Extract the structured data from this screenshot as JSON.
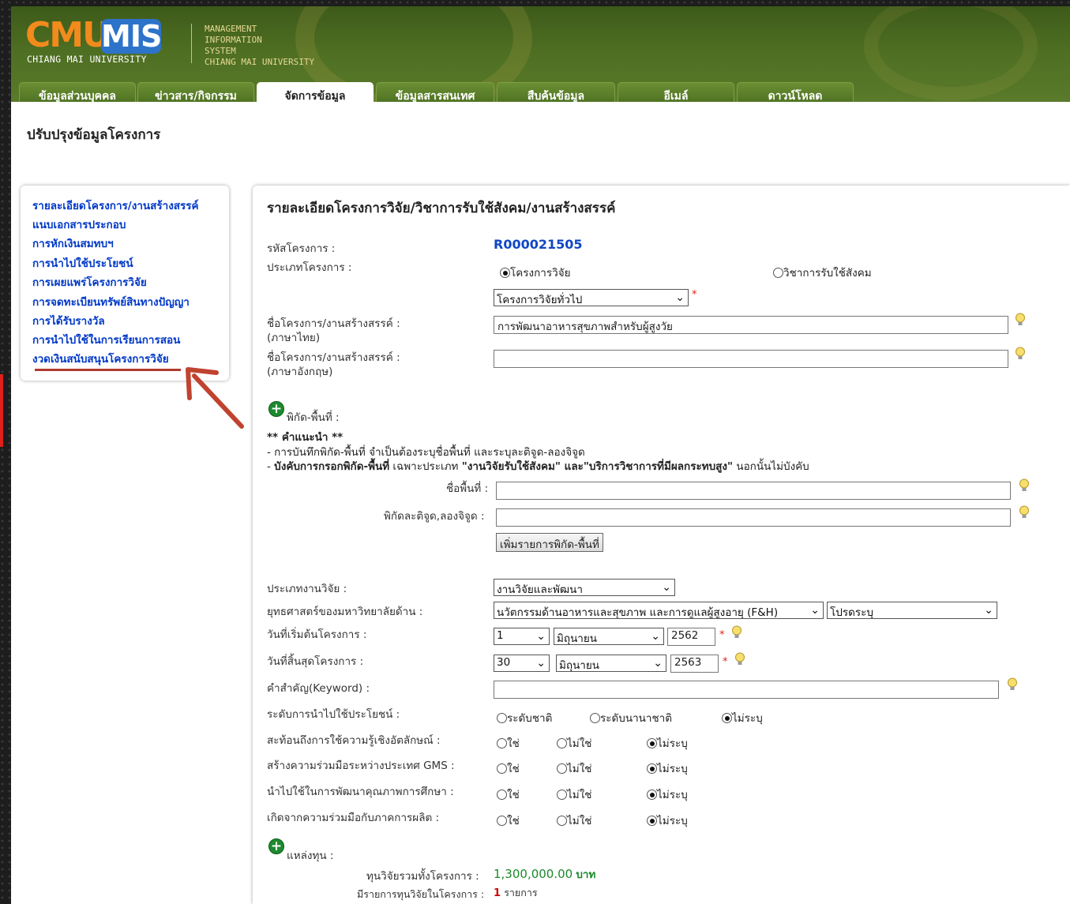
{
  "header": {
    "logo_cmu": "CMU",
    "logo_mis": "MIS",
    "logo_sub": "CHIANG MAI UNIVERSITY",
    "mis_line1": "MANAGEMENT",
    "mis_line2": "INFORMATION",
    "mis_line3": "SYSTEM",
    "mis_line4": "CHIANG MAI UNIVERSITY",
    "tabs": [
      {
        "label": "ข้อมูลส่วนบุคคล"
      },
      {
        "label": "ข่าวสาร/กิจกรรม"
      },
      {
        "label": "จัดการข้อมูล"
      },
      {
        "label": "ข้อมูลสารสนเทศ"
      },
      {
        "label": "สืบค้นข้อมูล"
      },
      {
        "label": "อีเมล์"
      },
      {
        "label": "ดาวน์โหลด"
      }
    ]
  },
  "page_title": "ปรับปรุงข้อมูลโครงการ",
  "sidebar": {
    "items": [
      {
        "label": "รายละเอียดโครงการ/งานสร้างสรรค์"
      },
      {
        "label": "แนบเอกสารประกอบ"
      },
      {
        "label": "การหักเงินสมทบฯ"
      },
      {
        "label": "การนำไปใช้ประโยชน์"
      },
      {
        "label": "การเผยแพร่โครงการวิจัย"
      },
      {
        "label": "การจดทะเบียนทรัพย์สินทางปัญญา"
      },
      {
        "label": "การได้รับรางวัล"
      },
      {
        "label": "การนำไปใช้ในการเรียนการสอน"
      },
      {
        "label": "งวดเงินสนับสนุนโครงการวิจัย"
      }
    ]
  },
  "form": {
    "heading": "รายละเอียดโครงการวิจัย/วิชาการรับใช้สังคม/งานสร้างสรรค์",
    "project_code_label": "รหัสโครงการ :",
    "project_code": "R000021505",
    "project_type_label": "ประเภทโครงการ :",
    "project_type_opt1": "โครงการวิจัย",
    "project_type_opt2": "วิชาการรับใช้สังคม",
    "project_subtype": "โครงการวิจัยทั่วไป",
    "name_th_label": "ชื่อโครงการ/งานสร้างสรรค์ :",
    "name_th_sub": "(ภาษาไทย)",
    "name_th_value": "การพัฒนาอาหารสุขภาพสำหรับผู้สูงวัย",
    "name_en_label": "ชื่อโครงการ/งานสร้างสรรค์ :",
    "name_en_sub": "(ภาษาอังกฤษ)",
    "name_en_value": "",
    "location_label": "พิกัด-พื้นที่ :",
    "advice_title": "** คำแนะนำ **",
    "advice_line1": "- การบันทึกพิกัด-พื้นที่ จำเป็นต้องระบุชื่อพื้นที่ และระบุละติจูด-ลองจิจูด",
    "advice_line2_prefix": "- ",
    "advice_line2_bold": "บังคับการกรอกพิกัด-พื้นที่",
    "advice_line2_mid": " เฉพาะประเภท ",
    "advice_line2_q": "\"งานวิจัยรับใช้สังคม\" และ\"บริการวิชาการที่มีผลกระทบสูง\"",
    "advice_line2_end": " นอกนั้นไม่บังคับ",
    "area_name_label": "ชื่อพื้นที่ :",
    "latlng_label": "พิกัดละติจูด,ลองจิจูด :",
    "add_location_button": "เพิ่มรายการพิกัด-พื้นที่",
    "research_type_label": "ประเภทงานวิจัย :",
    "research_type_value": "งานวิจัยและพัฒนา",
    "strategy_label": "ยุทธศาสตร์ของมหาวิทยาลัยด้าน :",
    "strategy_value": "นวัตกรรมด้านอาหารและสุขภาพ และการดูแลผู้สูงอายุ (F&H)",
    "strategy_sub_value": "โปรดระบุ",
    "start_date_label": "วันที่เริ่มต้นโครงการ :",
    "start_day": "1",
    "start_month": "มิถุนายน",
    "start_year": "2562",
    "end_date_label": "วันที่สิ้นสุดโครงการ :",
    "end_day": "30",
    "end_month": "มิถุนายน",
    "end_year": "2563",
    "keyword_label": "คำสำคัญ(Keyword) :",
    "keyword_value": "",
    "benefit_level_label": "ระดับการนำไปใช้ประโยชน์ :",
    "benefit_opt1": "ระดับชาติ",
    "benefit_opt2": "ระดับนานาชาติ",
    "benefit_opt3": "ไม่ระบุ",
    "q1_label": "สะท้อนถึงการใช้ความรู้เชิงอัตลักษณ์ :",
    "q2_label": "สร้างความร่วมมือระหว่างประเทศ GMS :",
    "q3_label": "นำไปใช้ในการพัฒนาคุณภาพการศึกษา :",
    "q4_label": "เกิดจากความร่วมมือกับภาคการผลิต :",
    "yes": "ใช่",
    "no": "ไม่ใช่",
    "unspecified": "ไม่ระบุ",
    "funding_label": "แหล่งทุน :",
    "total_fund_label": "ทุนวิจัยรวมทั้งโครงการ :",
    "total_fund_value": "1,300,000.00",
    "total_fund_unit": "บาท",
    "fund_items_label": "มีรายการทุนวิจัยในโครงการ :",
    "fund_items_count": "1",
    "fund_items_unit": "รายการ"
  },
  "colors": {
    "header_green": "#4e6e22",
    "link_blue": "#0038c8",
    "code_blue": "#1047c5",
    "logo_orange": "#f28a1c",
    "logo_blue": "#2d73c9",
    "required_red": "#e0201a",
    "fund_green": "#1a8a2a"
  }
}
